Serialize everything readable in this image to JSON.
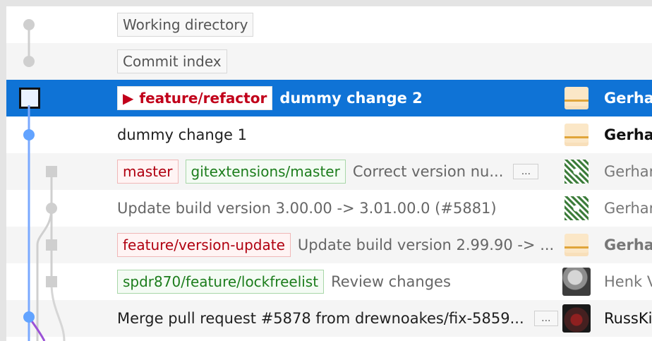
{
  "rows": [
    {
      "type": "virtual",
      "message": "Working directory"
    },
    {
      "type": "virtual",
      "message": "Commit index"
    },
    {
      "type": "commit",
      "selected": true,
      "current_branch": "feature/refactor",
      "message": "dummy change 2",
      "author": "Gerha",
      "avatar": "pixel-avatar"
    },
    {
      "type": "commit",
      "message": "dummy change 1",
      "author": "Gerha",
      "avatar": "pixel-avatar"
    },
    {
      "type": "commit",
      "refs": [
        {
          "label": "master",
          "kind": "red"
        },
        {
          "label": "gitextensions/master",
          "kind": "green"
        }
      ],
      "message": "Correct version nu...",
      "author": "Gerhar",
      "avatar": "pattern-avatar",
      "more": "..."
    },
    {
      "type": "commit",
      "message": "Update build version 3.00.00 -> 3.01.00.0 (#5881)",
      "author": "Gerhar",
      "avatar": "pattern-avatar"
    },
    {
      "type": "commit",
      "refs": [
        {
          "label": "feature/version-update",
          "kind": "red"
        }
      ],
      "message": "Update build version 2.99.90 -> ...",
      "author": "Gerha",
      "avatar": "pixel-avatar"
    },
    {
      "type": "commit",
      "refs": [
        {
          "label": "spdr870/feature/lockfreelist",
          "kind": "green"
        }
      ],
      "message": "Review changes",
      "author": "Henk V",
      "avatar": "photo-avatar"
    },
    {
      "type": "commit",
      "message": "Merge pull request #5878 from drewnoakes/fix-5859...",
      "author": "RussKi",
      "avatar": "red-photo-avatar",
      "more": "..."
    }
  ],
  "colors": {
    "selected": "#0f73d6",
    "line_gray": "#cfcfcf",
    "line_blue": "#7aa9ff",
    "line_purple": "#9b52d6",
    "node_blue": "#62a3ff",
    "node_gray": "#cfcfcf"
  }
}
